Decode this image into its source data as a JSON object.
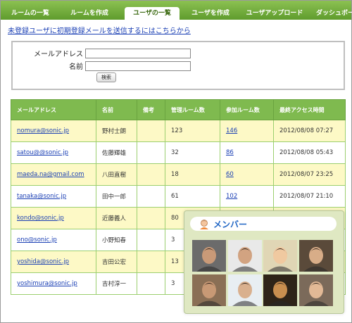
{
  "tabs": [
    {
      "label": "ルームの一覧"
    },
    {
      "label": "ルームを作成"
    },
    {
      "label": "ユーザの一覧"
    },
    {
      "label": "ユーザを作成"
    },
    {
      "label": "ユーザアップロード"
    },
    {
      "label": "ダッシュボー"
    }
  ],
  "top_link": "未登録ユーザに初期登録メールを送信するにはこちらから",
  "search": {
    "email_label": "メールアドレス",
    "name_label": "名前",
    "email_value": "",
    "name_value": "",
    "button": "検索"
  },
  "table": {
    "headers": [
      "メールアドレス",
      "名前",
      "備考",
      "管理ルーム数",
      "参加ルーム数",
      "最終アクセス時間"
    ],
    "rows": [
      {
        "email": "nomura@sonic.jp",
        "name": "野村士朗",
        "note": "",
        "managed": "123",
        "joined": "146",
        "last": "2012/08/08 07:27"
      },
      {
        "email": "satou@@sonic.jp",
        "name": "佐藤輝雄",
        "note": "",
        "managed": "32",
        "joined": "86",
        "last": "2012/08/08 05:43"
      },
      {
        "email": "maeda.na@gmail.com",
        "name": "八田直樹",
        "note": "",
        "managed": "18",
        "joined": "60",
        "last": "2012/08/07 23:25"
      },
      {
        "email": "tanaka@sonic.jp",
        "name": "田中一郎",
        "note": "",
        "managed": "61",
        "joined": "102",
        "last": "2012/08/07 21:10"
      },
      {
        "email": "kondo@sonic.jp",
        "name": "近藤義人",
        "note": "",
        "managed": "80",
        "joined": "",
        "last": ""
      },
      {
        "email": "ono@sonic.jp",
        "name": "小野知春",
        "note": "",
        "managed": "3",
        "joined": "",
        "last": ""
      },
      {
        "email": "yoshida@sonic.jp",
        "name": "吉田公宏",
        "note": "",
        "managed": "13",
        "joined": "",
        "last": ""
      },
      {
        "email": "yoshimura@sonic.jp",
        "name": "吉村淳一",
        "note": "",
        "managed": "3",
        "joined": "",
        "last": ""
      }
    ]
  },
  "member_panel": {
    "title": "メンバー",
    "photos": [
      {
        "bg": "#6b6b6b",
        "face": "#c99a78"
      },
      {
        "bg": "#e9e9e9",
        "face": "#d2a381"
      },
      {
        "bg": "#e0d6b5",
        "face": "#f0c9a0"
      },
      {
        "bg": "#5a4a3a",
        "face": "#d8ad88"
      },
      {
        "bg": "#8a6f55",
        "face": "#c89975"
      },
      {
        "bg": "#e8eef2",
        "face": "#d9b08e"
      },
      {
        "bg": "#2e2418",
        "face": "#c98f4f"
      },
      {
        "bg": "#7b6a5a",
        "face": "#e2b996"
      }
    ]
  },
  "colors": {
    "accent": "#7fba4f",
    "link": "#1a3fb4",
    "highlight_row": "#fdf9c6"
  }
}
